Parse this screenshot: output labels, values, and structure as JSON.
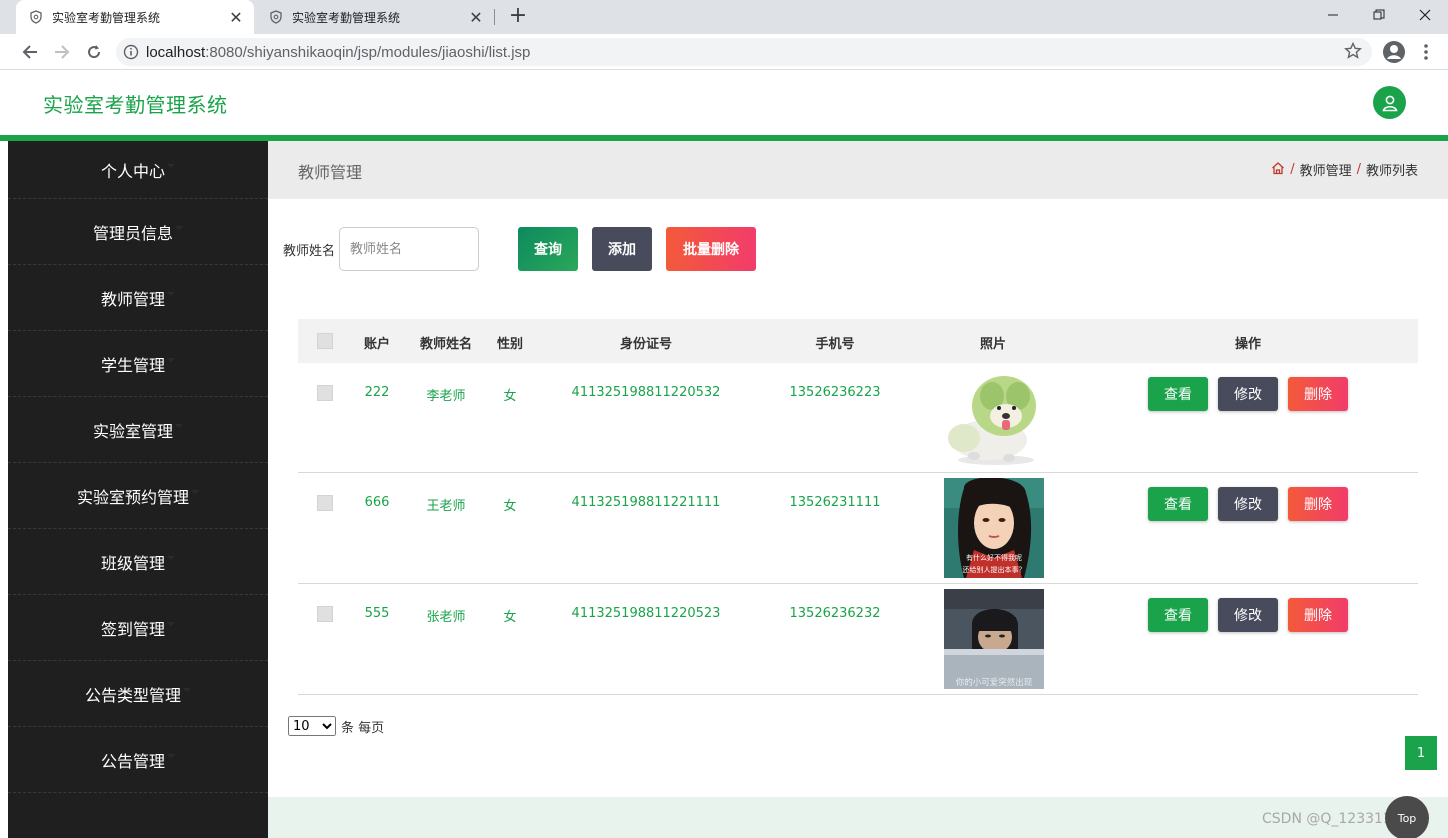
{
  "browser": {
    "tabs": [
      {
        "title": "实验室考勤管理系统",
        "active": true
      },
      {
        "title": "实验室考勤管理系统",
        "active": false
      }
    ],
    "url_host": "localhost",
    "url_rest": ":8080/shiyanshikaoqin/jsp/modules/jiaoshi/list.jsp"
  },
  "header": {
    "app_title": "实验室考勤管理系统",
    "accent_color": "#1aa34a"
  },
  "sidebar": {
    "items": [
      {
        "label": "个人中心"
      },
      {
        "label": "管理员信息"
      },
      {
        "label": "教师管理"
      },
      {
        "label": "学生管理"
      },
      {
        "label": "实验室管理"
      },
      {
        "label": "实验室预约管理"
      },
      {
        "label": "班级管理"
      },
      {
        "label": "签到管理"
      },
      {
        "label": "公告类型管理"
      },
      {
        "label": "公告管理"
      }
    ]
  },
  "page": {
    "title": "教师管理",
    "breadcrumb": [
      "教师管理",
      "教师列表"
    ]
  },
  "search": {
    "label": "教师姓名",
    "placeholder": "教师姓名",
    "query_label": "查询",
    "add_label": "添加",
    "batch_delete_label": "批量删除"
  },
  "table": {
    "headers": {
      "account": "账户",
      "name": "教师姓名",
      "gender": "性别",
      "id_number": "身份证号",
      "phone": "手机号",
      "photo": "照片",
      "actions": "操作"
    },
    "rows": [
      {
        "account": "222",
        "name": "李老师",
        "gender": "女",
        "id_number": "411325198811220532",
        "phone": "13526236223",
        "photo": "cabbage-dog"
      },
      {
        "account": "666",
        "name": "王老师",
        "gender": "女",
        "id_number": "411325198811221111",
        "phone": "13526231111",
        "photo": "anime-woman",
        "photo_caption": [
          "有什么好不得我呢",
          "还给别人提出本事？"
        ]
      },
      {
        "account": "555",
        "name": "张老师",
        "gender": "女",
        "id_number": "411325198811220523",
        "phone": "13526236232",
        "photo": "peeking-man",
        "photo_caption": [
          "你的小可爱突然出现"
        ]
      }
    ],
    "action_labels": {
      "view": "查看",
      "edit": "修改",
      "delete": "删除"
    }
  },
  "pagination": {
    "page_size": "10",
    "page_size_suffix": "条 每页",
    "current_page": "1"
  },
  "watermark": "CSDN @Q_1233111097",
  "top_button": "Top"
}
